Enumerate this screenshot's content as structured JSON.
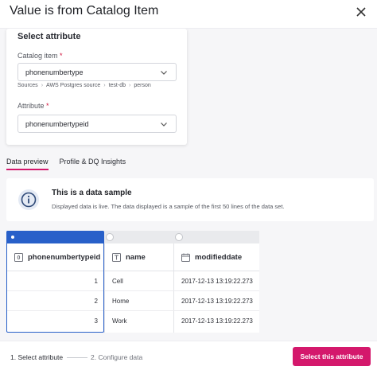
{
  "modal": {
    "title": "Value is from Catalog Item"
  },
  "attribute_card": {
    "heading": "Select attribute",
    "catalog_item_label": "Catalog item",
    "catalog_item_required": "*",
    "catalog_item_value": "phonenumbertype",
    "breadcrumb": [
      "Sources",
      "AWS Postgres source",
      "test-db",
      "person"
    ],
    "breadcrumb_sep": "›",
    "attribute_label": "Attribute",
    "attribute_required": "*",
    "attribute_value": "phonenumbertypeid"
  },
  "tabs": [
    {
      "label": "Data preview",
      "active": true
    },
    {
      "label": "Profile & DQ Insights",
      "active": false
    }
  ],
  "info_banner": {
    "icon": "info-icon",
    "title": "This is a data sample",
    "text": "Displayed data is live. The data displayed is a sample of the first 50 lines of the data set."
  },
  "table": {
    "columns": [
      {
        "name": "phonenumbertypeid",
        "type_icon": "number-type-icon",
        "selected": true
      },
      {
        "name": "name",
        "type_icon": "text-type-icon",
        "selected": false
      },
      {
        "name": "modifieddate",
        "type_icon": "calendar-icon",
        "selected": false
      }
    ],
    "rows": [
      [
        "1",
        "Cell",
        "2017-12-13 13:19:22.273"
      ],
      [
        "2",
        "Home",
        "2017-12-13 13:19:22.273"
      ],
      [
        "3",
        "Work",
        "2017-12-13 13:19:22.273"
      ]
    ]
  },
  "footer": {
    "step1": "1. Select attribute",
    "step2": "2. Configure data",
    "primary_button": "Select this attribute"
  },
  "colors": {
    "accent": "#d4186c",
    "selection": "#2860c9"
  }
}
